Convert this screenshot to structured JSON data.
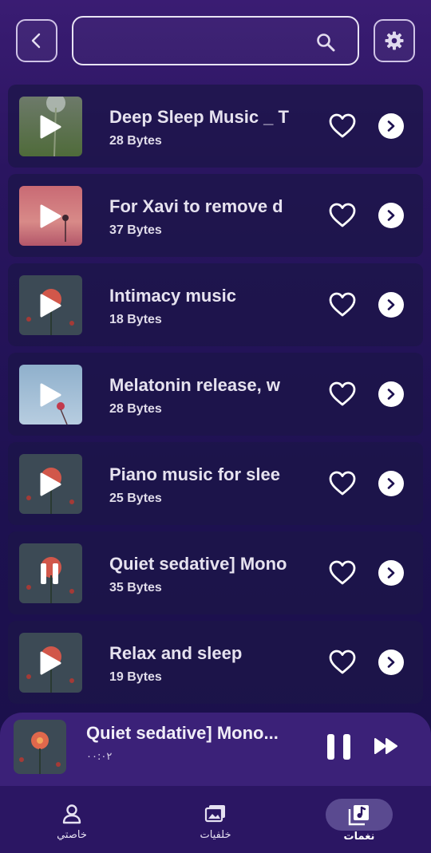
{
  "search": {
    "placeholder": ""
  },
  "tracks": [
    {
      "title": "Deep Sleep Music _ T",
      "size": "28 Bytes",
      "state": "play",
      "thumb": "green-dandelion"
    },
    {
      "title": "For Xavi to remove d",
      "size": "37 Bytes",
      "state": "play",
      "thumb": "pink-dusk"
    },
    {
      "title": "Intimacy music",
      "size": "18 Bytes",
      "state": "play",
      "thumb": "red-flower-night"
    },
    {
      "title": "Melatonin release, w",
      "size": "28 Bytes",
      "state": "play",
      "thumb": "blue-sky-flower"
    },
    {
      "title": "Piano music for slee",
      "size": "25 Bytes",
      "state": "play",
      "thumb": "red-flower-night"
    },
    {
      "title": "Quiet sedative] Mono",
      "size": "35 Bytes",
      "state": "pause",
      "thumb": "red-flower-night"
    },
    {
      "title": "Relax and sleep",
      "size": "19 Bytes",
      "state": "play",
      "thumb": "red-flower-night"
    }
  ],
  "player": {
    "title": "Quiet sedative] Mono...",
    "time": "۰۰:۰۲"
  },
  "nav": {
    "profile_label": "خاصتي",
    "wallpapers_label": "خلفيات",
    "tones_label": "نغمات"
  },
  "colors": {
    "background": "#1d1150",
    "card": "#1c1648",
    "player": "#3b2178",
    "nav": "#2b1663",
    "nav_active_pill": "#5a4a90"
  }
}
